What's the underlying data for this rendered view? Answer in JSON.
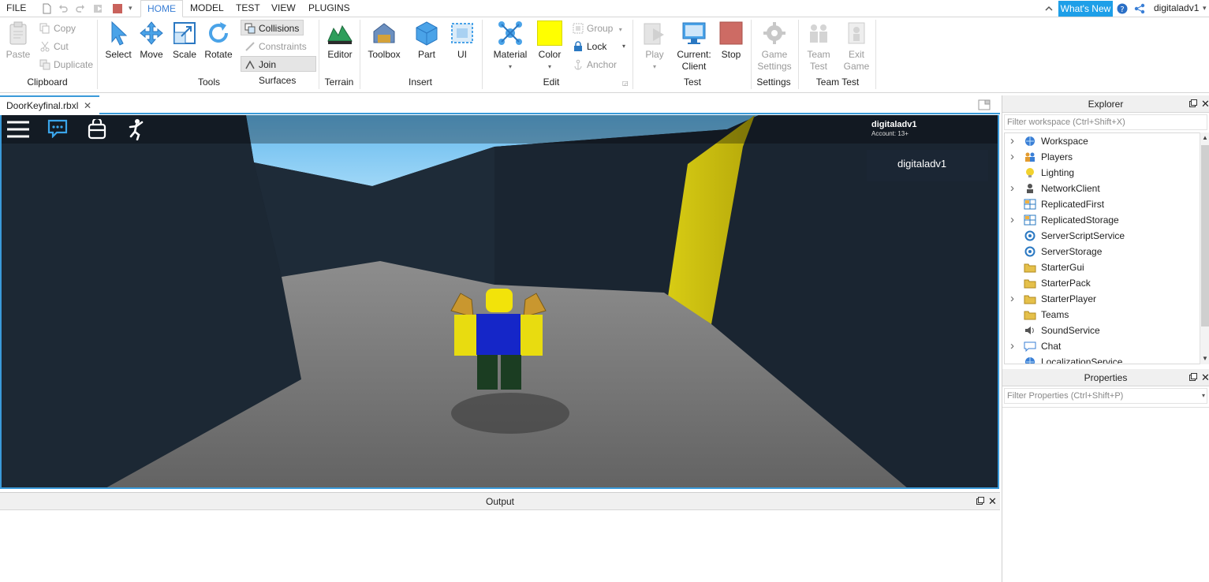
{
  "menubar": {
    "file": "FILE",
    "tabs": [
      "HOME",
      "MODEL",
      "TEST",
      "VIEW",
      "PLUGINS"
    ],
    "whats_new": "What's New",
    "username": "digitaladv1"
  },
  "ribbon": {
    "clipboard": {
      "group": "Clipboard",
      "paste": "Paste",
      "copy": "Copy",
      "cut": "Cut",
      "duplicate": "Duplicate"
    },
    "tools": {
      "group": "Tools",
      "select": "Select",
      "move": "Move",
      "scale": "Scale",
      "rotate": "Rotate",
      "collisions": "Collisions",
      "constraints": "Constraints",
      "join_surfaces": "Join Surfaces"
    },
    "terrain": {
      "group": "Terrain",
      "editor": "Editor"
    },
    "insert": {
      "group": "Insert",
      "toolbox": "Toolbox",
      "part": "Part",
      "ui": "UI"
    },
    "edit": {
      "group": "Edit",
      "material": "Material",
      "color": "Color",
      "group_btn": "Group",
      "lock": "Lock",
      "anchor": "Anchor",
      "color_swatch": "#ffff00"
    },
    "test": {
      "group": "Test",
      "play": "Play",
      "current_client_1": "Current:",
      "current_client_2": "Client",
      "stop": "Stop"
    },
    "settings": {
      "group": "Settings",
      "game_settings_1": "Game",
      "game_settings_2": "Settings"
    },
    "team_test": {
      "group": "Team Test",
      "team_test_1": "Team",
      "team_test_2": "Test",
      "exit_game_1": "Exit",
      "exit_game_2": "Game"
    }
  },
  "document": {
    "tab": "DoorKeyfinal.rbxl"
  },
  "viewport": {
    "player_name": "digitaladv1",
    "account": "Account: 13+",
    "leaderboard_name": "digitaladv1"
  },
  "output": {
    "title": "Output"
  },
  "explorer": {
    "title": "Explorer",
    "filter_placeholder": "Filter workspace (Ctrl+Shift+X)",
    "items": [
      {
        "label": "Workspace",
        "expandable": true,
        "icon": "workspace-icon"
      },
      {
        "label": "Players",
        "expandable": true,
        "icon": "players-icon"
      },
      {
        "label": "Lighting",
        "expandable": false,
        "icon": "lighting-icon"
      },
      {
        "label": "NetworkClient",
        "expandable": true,
        "icon": "network-client-icon"
      },
      {
        "label": "ReplicatedFirst",
        "expandable": false,
        "icon": "replicated-first-icon"
      },
      {
        "label": "ReplicatedStorage",
        "expandable": true,
        "icon": "replicated-storage-icon"
      },
      {
        "label": "ServerScriptService",
        "expandable": false,
        "icon": "server-script-service-icon"
      },
      {
        "label": "ServerStorage",
        "expandable": false,
        "icon": "server-storage-icon"
      },
      {
        "label": "StarterGui",
        "expandable": false,
        "icon": "starter-gui-icon"
      },
      {
        "label": "StarterPack",
        "expandable": false,
        "icon": "starter-pack-icon"
      },
      {
        "label": "StarterPlayer",
        "expandable": true,
        "icon": "starter-player-icon"
      },
      {
        "label": "Teams",
        "expandable": false,
        "icon": "teams-icon"
      },
      {
        "label": "SoundService",
        "expandable": false,
        "icon": "sound-service-icon"
      },
      {
        "label": "Chat",
        "expandable": true,
        "icon": "chat-icon"
      },
      {
        "label": "LocalizationService",
        "expandable": false,
        "icon": "localization-service-icon"
      }
    ]
  },
  "properties": {
    "title": "Properties",
    "filter_placeholder": "Filter Properties (Ctrl+Shift+P)"
  }
}
